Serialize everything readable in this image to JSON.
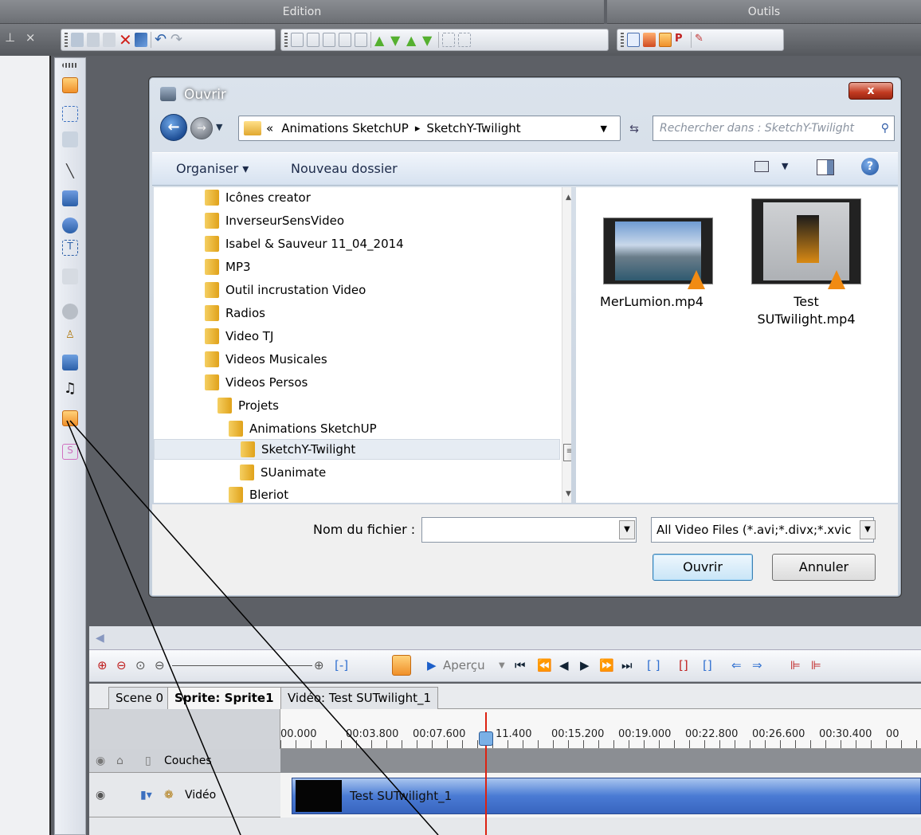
{
  "ribbon": {
    "group_edition": "Edition",
    "group_outils": "Outils",
    "pin": "⊥ ×"
  },
  "dialog": {
    "title": "Ouvrir",
    "close": "x",
    "breadcrumb": {
      "prefix": "«",
      "item1": "Animations SketchUP",
      "item2": "SketchY-Twilight"
    },
    "search_placeholder": "Rechercher dans : SketchY-Twilight",
    "organiser": "Organiser ▾",
    "nouveau_dossier": "Nouveau dossier",
    "tree": [
      "Icônes creator",
      "InverseurSensVideo",
      "Isabel & Sauveur 11_04_2014",
      "MP3",
      "Outil incrustation Video",
      "Radios",
      "Video TJ",
      "Videos Musicales",
      "Videos Persos",
      "Projets",
      "Animations SketchUP",
      "SketchY-Twilight",
      "SUanimate",
      "Bleriot"
    ],
    "files": [
      {
        "name": "MerLumion.mp4"
      },
      {
        "name_line1": "Test",
        "name_line2": "SUTwilight.mp4"
      }
    ],
    "filename_label": "Nom du fichier :",
    "filename_value": "",
    "filter": "All Video Files (*.avi;*.divx;*.xvic",
    "btn_open": "Ouvrir",
    "btn_cancel": "Annuler"
  },
  "timeline": {
    "apercu": "Aperçu",
    "tabs": [
      "Scene 0",
      "Sprite: Sprite1",
      "Vidéo: Test SUTwilight_1"
    ],
    "ticks": [
      "00.000",
      "00:03.800",
      "00:07.600",
      "11.400",
      "00:15.200",
      "00:19.000",
      "00:22.800",
      "00:26.600",
      "00:30.400",
      "00"
    ],
    "layers_label": "Couches",
    "video_label": "Vidéo",
    "clip_label": "Test SUTwilight_1"
  }
}
